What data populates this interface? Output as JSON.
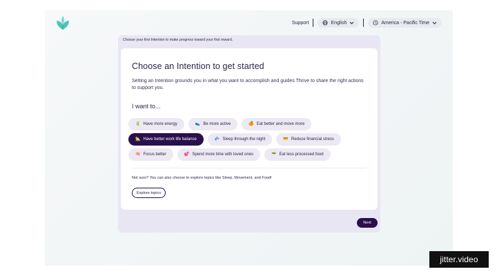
{
  "topnav": {
    "support": "Support",
    "language": "English",
    "timezone": "America - Pacific Time"
  },
  "banner": "Choose your first Intention to make progress toward your first reward.",
  "main": {
    "title": "Choose an Intention to get started",
    "description": "Setting an Intention grounds you in what you want to accomplish and guides Thrive to share the right actions to support you.",
    "prompt": "I want to...",
    "chips_row1": [
      {
        "icon": "🔋",
        "label": "Have more energy"
      },
      {
        "icon": "👟",
        "label": "Be more active"
      },
      {
        "icon": "🍊",
        "label": "Eat better and move more"
      }
    ],
    "chips_row2": [
      {
        "icon": "🏡",
        "label": "Have better work life balance"
      },
      {
        "icon": "💤",
        "label": "Sleep through the night"
      },
      {
        "icon": "💳",
        "label": "Reduce financial stress"
      }
    ],
    "chips_row3": [
      {
        "icon": "🧠",
        "label": "Focus better"
      },
      {
        "icon": "💕",
        "label": "Spend more time with loved ones"
      },
      {
        "icon": "🥗",
        "label": "Eat less processed food"
      }
    ],
    "selected": "Have better work life balance",
    "not_sure": "Not sure? You can also choose to explore topics like Sleep, Movement, and Food!",
    "explore_label": "Explore topics"
  },
  "next_label": "Next",
  "watermark": "jitter.video",
  "colors": {
    "accent": "#2a0f4d",
    "chip_bg": "#ece9f4",
    "card_outer": "#e9e6f3",
    "logo": "#4fc3b8"
  }
}
